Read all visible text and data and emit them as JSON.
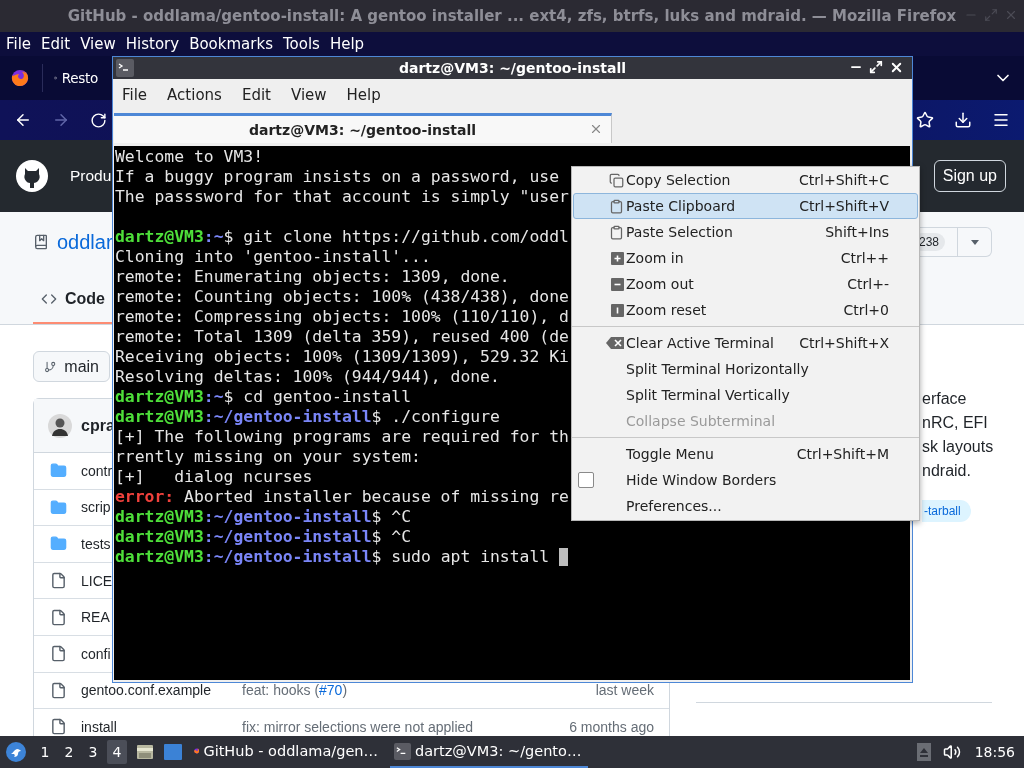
{
  "firefox": {
    "title": "GitHub - oddlama/gentoo-install: A gentoo installer ...  ext4, zfs, btrfs, luks and mdraid. — Mozilla Firefox",
    "menu": [
      "File",
      "Edit",
      "View",
      "History",
      "Bookmarks",
      "Tools",
      "Help"
    ],
    "tab": {
      "label": "Resto"
    }
  },
  "github": {
    "nav_item": "Produ",
    "signup": "Sign up",
    "repo_name": "oddlar",
    "counter": "238",
    "tabs": [
      {
        "label": "Code",
        "selected": true
      }
    ],
    "branch": "main",
    "commit_author": "cpra",
    "files": [
      {
        "name": "contr",
        "kind": "folder"
      },
      {
        "name": "scrip",
        "kind": "folder"
      },
      {
        "name": "tests",
        "kind": "folder"
      },
      {
        "name": "LICE",
        "kind": "file"
      },
      {
        "name": "REA",
        "kind": "file"
      },
      {
        "name": "confi",
        "kind": "file"
      },
      {
        "name": "gentoo.conf.example",
        "kind": "file",
        "message": "feat: hooks (",
        "link": "#70",
        "message_end": ")",
        "time": "last week"
      },
      {
        "name": "install",
        "kind": "file",
        "message": "fix: mirror selections were not applied",
        "time": "6 months ago"
      }
    ],
    "about_lines": [
      "erface",
      "nRC, EFI",
      "sk layouts",
      "ndraid."
    ],
    "topic": "-tarball"
  },
  "terminal": {
    "title": "dartz@VM3: ~/gentoo-install",
    "menu": [
      "File",
      "Actions",
      "Edit",
      "View",
      "Help"
    ],
    "tabs": [
      {
        "label": "dartz@VM3: ~/gentoo-install",
        "selected": true
      }
    ],
    "lines": [
      {
        "kind": "text",
        "text": "Welcome to VM3!"
      },
      {
        "kind": "text",
        "text": "If a buggy program insists on a password, use"
      },
      {
        "kind": "text",
        "text": "The passsword for that account is simply \"user"
      },
      {
        "kind": "blank"
      },
      {
        "kind": "prompt",
        "user": "dartz@VM3",
        "path": ":~",
        "command": "$ git clone https://github.com/oddl",
        "cursor": false
      },
      {
        "kind": "text",
        "text": "Cloning into 'gentoo-install'..."
      },
      {
        "kind": "text",
        "text": "remote: Enumerating objects: 1309, done."
      },
      {
        "kind": "text",
        "text": "remote: Counting objects: 100% (438/438), done"
      },
      {
        "kind": "text",
        "text": "remote: Compressing objects: 100% (110/110), d"
      },
      {
        "kind": "text",
        "text": "remote: Total 1309 (delta 359), reused 400 (de"
      },
      {
        "kind": "text",
        "text": "Receiving objects: 100% (1309/1309), 529.32 Ki"
      },
      {
        "kind": "text",
        "text": "Resolving deltas: 100% (944/944), done."
      },
      {
        "kind": "prompt",
        "user": "dartz@VM3",
        "path": ":~",
        "command": "$ cd gentoo-install",
        "cursor": false
      },
      {
        "kind": "prompt",
        "user": "dartz@VM3",
        "path": ":~/gentoo-install",
        "command": "$ ./configure",
        "cursor": false
      },
      {
        "kind": "text",
        "text": "[+] The following programs are required for th"
      },
      {
        "kind": "text",
        "text": "rrently missing on your system:"
      },
      {
        "kind": "text",
        "text": "[+]   dialog ncurses"
      },
      {
        "kind": "error",
        "label": "error:",
        "text": "Aborted installer because of missing re"
      },
      {
        "kind": "prompt",
        "user": "dartz@VM3",
        "path": ":~/gentoo-install",
        "command": "$ ^C",
        "cursor": false
      },
      {
        "kind": "prompt",
        "user": "dartz@VM3",
        "path": ":~/gentoo-install",
        "command": "$ ^C",
        "cursor": false
      },
      {
        "kind": "prompt",
        "user": "dartz@VM3",
        "path": ":~/gentoo-install",
        "command": "$ sudo apt install ",
        "cursor": true
      }
    ]
  },
  "context_menu": {
    "groups": [
      [
        {
          "kind": "copy",
          "label": "Copy Selection",
          "shortcut": "Ctrl+Shift+C",
          "selected": false,
          "disabled": false
        },
        {
          "kind": "paste",
          "label": "Paste Clipboard",
          "shortcut": "Ctrl+Shift+V",
          "selected": true,
          "disabled": false
        },
        {
          "kind": "paste",
          "label": "Paste Selection",
          "shortcut": "Shift+Ins",
          "selected": false,
          "disabled": false
        },
        {
          "kind": "zoom-in",
          "label": "Zoom in",
          "shortcut": "Ctrl++",
          "selected": false,
          "disabled": false
        },
        {
          "kind": "zoom-out",
          "label": "Zoom out",
          "shortcut": "Ctrl+-",
          "selected": false,
          "disabled": false
        },
        {
          "kind": "zoom-reset",
          "label": "Zoom reset",
          "shortcut": "Ctrl+0",
          "selected": false,
          "disabled": false
        }
      ],
      [
        {
          "kind": "clear",
          "label": "Clear Active Terminal",
          "shortcut": "Ctrl+Shift+X",
          "selected": false,
          "disabled": false
        },
        {
          "kind": "plain",
          "label": "Split Terminal Horizontally",
          "selected": false,
          "disabled": false
        },
        {
          "kind": "plain",
          "label": "Split Terminal Vertically",
          "selected": false,
          "disabled": false
        },
        {
          "kind": "plain",
          "label": "Collapse Subterminal",
          "selected": false,
          "disabled": true
        }
      ],
      [
        {
          "kind": "plain",
          "label": "Toggle Menu",
          "shortcut": "Ctrl+Shift+M",
          "selected": false,
          "disabled": false
        },
        {
          "kind": "check",
          "label": "Hide Window Borders",
          "checked": false,
          "selected": false,
          "disabled": false
        },
        {
          "kind": "plain",
          "label": "Preferences...",
          "selected": false,
          "disabled": false
        }
      ]
    ]
  },
  "taskbar": {
    "workspaces": [
      {
        "label": "1",
        "selected": false
      },
      {
        "label": "2",
        "selected": false
      },
      {
        "label": "3",
        "selected": false
      },
      {
        "label": "4",
        "selected": true
      }
    ],
    "tasks": [
      {
        "kind": "browser",
        "label": "GitHub - oddlama/gen…",
        "selected": false
      },
      {
        "kind": "terminal",
        "label": "dartz@VM3: ~/gento…",
        "selected": true
      }
    ],
    "clock": "18:56"
  }
}
